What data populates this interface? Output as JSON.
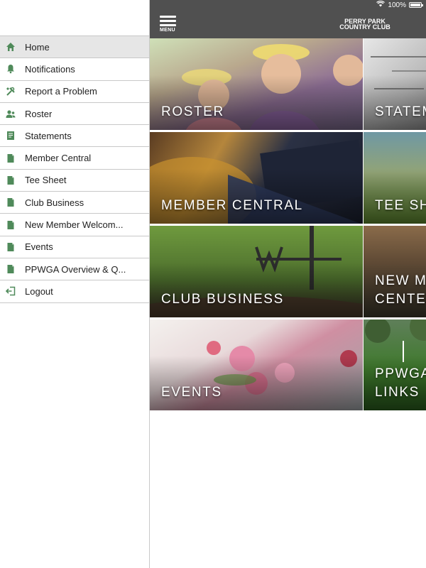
{
  "status_bar": {
    "battery": "100%"
  },
  "header": {
    "menu_label": "MENU",
    "club_name_line1": "PERRY PARK",
    "club_name_line2": "COUNTRY CLUB"
  },
  "sidebar": {
    "items": [
      {
        "label": "Home",
        "icon": "home-icon",
        "active": true
      },
      {
        "label": "Notifications",
        "icon": "bell-icon"
      },
      {
        "label": "Report a Problem",
        "icon": "tools-icon"
      },
      {
        "label": "Roster",
        "icon": "people-icon"
      },
      {
        "label": "Statements",
        "icon": "statement-icon"
      },
      {
        "label": "Member Central",
        "icon": "document-icon"
      },
      {
        "label": "Tee Sheet",
        "icon": "document-icon"
      },
      {
        "label": "Club Business",
        "icon": "document-icon"
      },
      {
        "label": "New Member Welcom...",
        "icon": "document-icon"
      },
      {
        "label": "Events",
        "icon": "document-icon"
      },
      {
        "label": "PPWGA Overview & Q...",
        "icon": "document-icon"
      },
      {
        "label": "Logout",
        "icon": "logout-icon"
      }
    ]
  },
  "tiles": {
    "roster": "ROSTER",
    "statements": "STATEM",
    "member_central": "MEMBER CENTRAL",
    "tee_sheet": "TEE SH",
    "club_business": "CLUB BUSINESS",
    "new_member_line1": "NEW ME",
    "new_member_line2": "CENTER",
    "events": "EVENTS",
    "ppwga_line1": "PPWGA",
    "ppwga_line2": "LINKS"
  },
  "colors": {
    "header_bg": "#505050",
    "icon_green": "#4f8a5a",
    "active_row": "#e6e6e6"
  }
}
